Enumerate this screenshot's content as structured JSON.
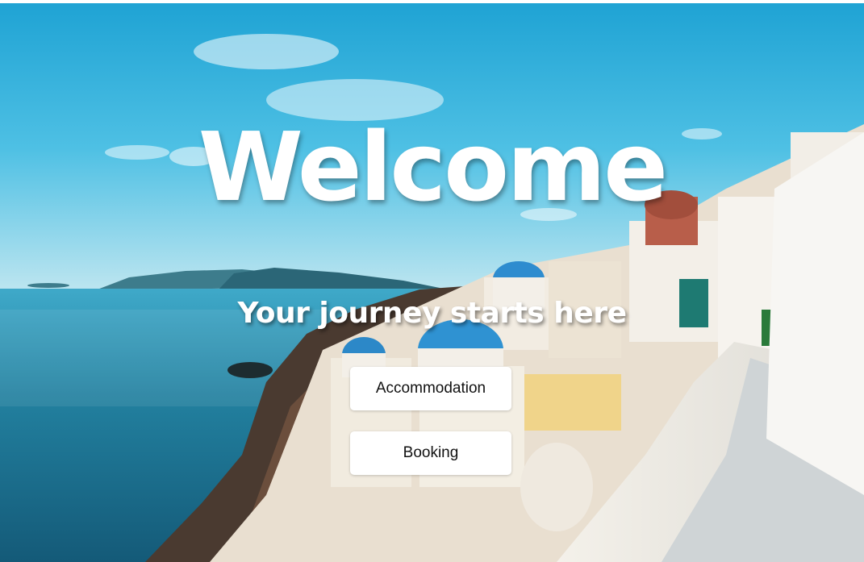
{
  "hero": {
    "title": "Welcome",
    "tagline": "Your journey starts here",
    "background_image": "santorini-coastline-photo"
  },
  "buttons": {
    "accommodation_label": "Accommodation",
    "booking_label": "Booking"
  },
  "colors": {
    "sky": "#38b7e0",
    "sea": "#1c6f92",
    "button_bg": "#ffffff",
    "title_text": "#ffffff"
  }
}
